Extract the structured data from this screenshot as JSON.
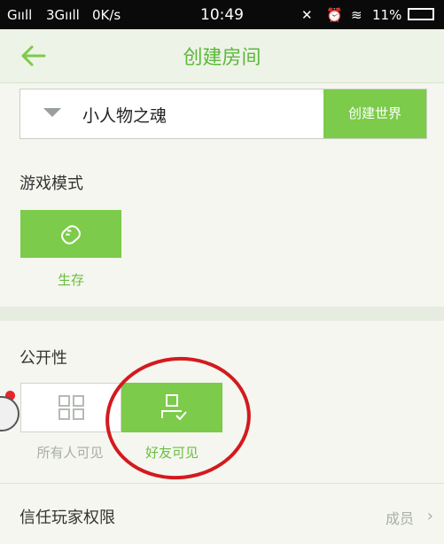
{
  "status_bar": {
    "signal1": "Gııll",
    "signal2": "3Gııll",
    "speed": "0K/s",
    "time": "10:49",
    "battery": "11%"
  },
  "header": {
    "title": "创建房间",
    "back_icon": "arrow-left-icon"
  },
  "world": {
    "selected": "小人物之魂",
    "create_label": "创建世界"
  },
  "game_mode": {
    "label": "游戏模式",
    "option_label": "生存"
  },
  "visibility": {
    "label": "公开性",
    "all_label": "所有人可见",
    "friends_label": "好友可见"
  },
  "trust": {
    "label": "信任玩家权限",
    "value": "成员"
  },
  "colors": {
    "accent": "#7ccb4a",
    "accent_text": "#5bb83b",
    "annotation": "#d31a1f"
  }
}
